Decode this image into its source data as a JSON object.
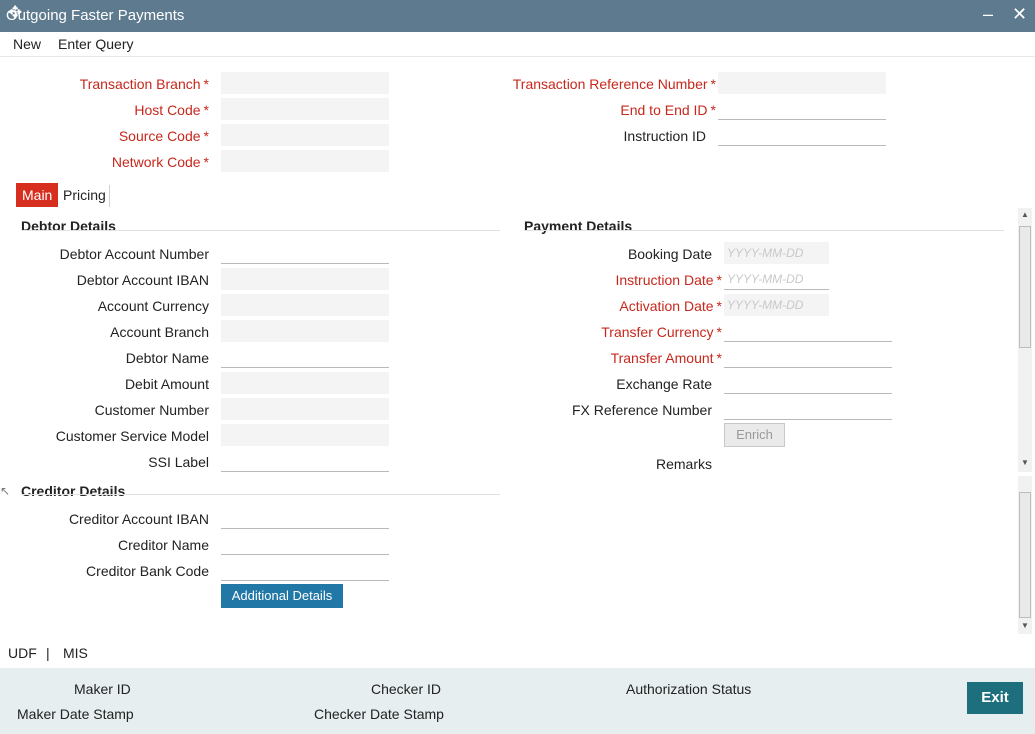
{
  "window": {
    "title": "Outgoing Faster Payments"
  },
  "menu": {
    "new": "New",
    "enter_query": "Enter Query"
  },
  "header_left": [
    {
      "label": "Transaction Branch",
      "required": true
    },
    {
      "label": "Host Code",
      "required": true
    },
    {
      "label": "Source Code",
      "required": true
    },
    {
      "label": "Network Code",
      "required": true
    }
  ],
  "header_right": [
    {
      "label": "Transaction Reference Number",
      "required": true
    },
    {
      "label": "End to End ID",
      "required": true
    },
    {
      "label": "Instruction ID",
      "required": false
    }
  ],
  "tabs": [
    {
      "label": "Main",
      "active": true
    },
    {
      "label": "Pricing",
      "active": false
    }
  ],
  "debtor": {
    "heading": "Debtor Details",
    "fields": [
      {
        "label": "Debtor Account Number",
        "style": "line"
      },
      {
        "label": "Debtor Account IBAN",
        "style": "gray"
      },
      {
        "label": "Account Currency",
        "style": "gray"
      },
      {
        "label": "Account Branch",
        "style": "gray"
      },
      {
        "label": "Debtor Name",
        "style": "line"
      },
      {
        "label": "Debit Amount",
        "style": "gray"
      },
      {
        "label": "Customer Number",
        "style": "gray"
      },
      {
        "label": "Customer Service Model",
        "style": "gray"
      },
      {
        "label": "SSI Label",
        "style": "line"
      }
    ]
  },
  "payment": {
    "heading": "Payment Details",
    "fields": [
      {
        "label": "Booking Date",
        "required": false,
        "placeholder": "YYYY-MM-DD"
      },
      {
        "label": "Instruction Date",
        "required": true,
        "placeholder": "YYYY-MM-DD"
      },
      {
        "label": "Activation Date",
        "required": true,
        "placeholder": "YYYY-MM-DD"
      },
      {
        "label": "Transfer Currency",
        "required": true
      },
      {
        "label": "Transfer Amount",
        "required": true
      },
      {
        "label": "Exchange Rate",
        "required": false
      },
      {
        "label": "FX Reference Number",
        "required": false
      }
    ],
    "enrich": "Enrich",
    "remarks": "Remarks"
  },
  "creditor": {
    "heading": "Creditor Details",
    "fields": [
      {
        "label": "Creditor Account IBAN"
      },
      {
        "label": "Creditor Name"
      },
      {
        "label": "Creditor Bank Code"
      }
    ],
    "additional": "Additional Details"
  },
  "bottom_links": {
    "udf": "UDF",
    "sep": "|",
    "mis": "MIS"
  },
  "footer": {
    "maker_id": "Maker ID",
    "maker_date": "Maker Date Stamp",
    "checker_id": "Checker ID",
    "checker_date": "Checker Date Stamp",
    "auth_status": "Authorization Status",
    "exit": "Exit"
  },
  "colors": {
    "title_bar": "#5e7a8f",
    "required": "#c8271c",
    "tab_active": "#d62e1f",
    "button_blue": "#2177a6",
    "exit": "#1e6f7e"
  }
}
